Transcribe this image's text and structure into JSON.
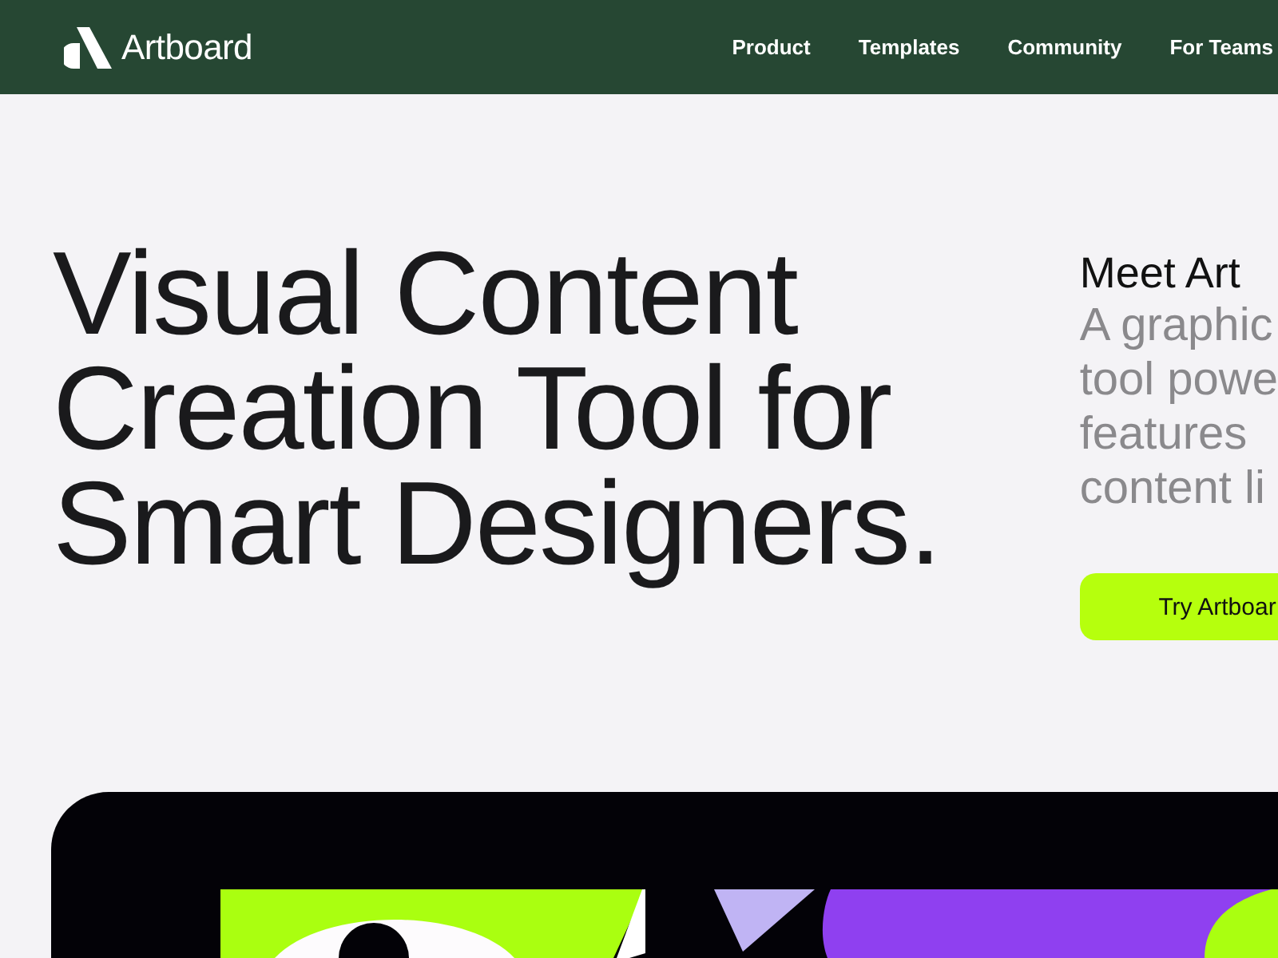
{
  "nav": {
    "brand": "Artboard",
    "links": [
      {
        "label": "Product"
      },
      {
        "label": "Templates"
      },
      {
        "label": "Community"
      },
      {
        "label": "For Teams"
      }
    ]
  },
  "hero": {
    "headline": [
      "Visual Content",
      "Creation Tool for",
      "Smart Designers."
    ],
    "intro_title": "Meet Art",
    "intro_lines": [
      "A graphic",
      "tool powe",
      "features",
      "content li"
    ],
    "cta": "Try Artboar"
  }
}
